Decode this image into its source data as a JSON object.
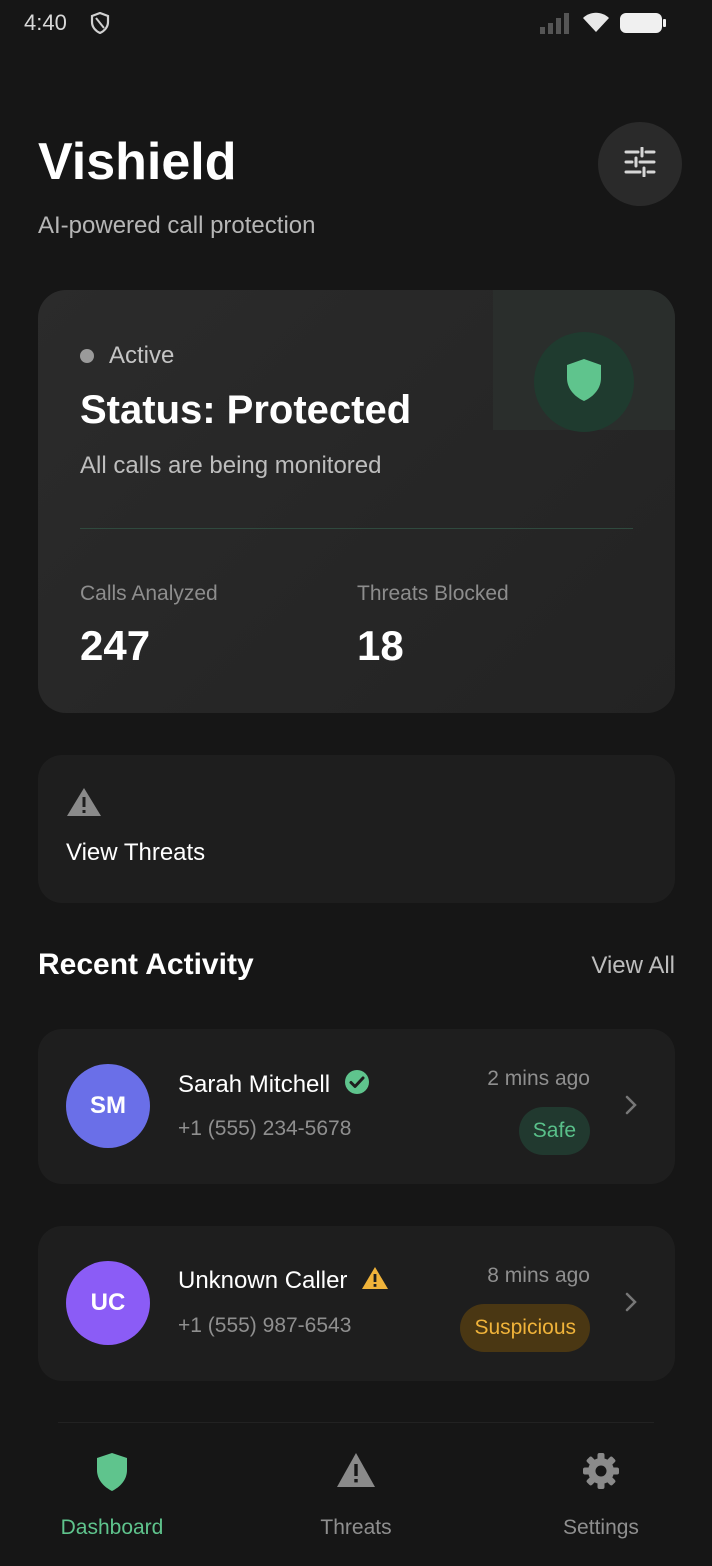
{
  "status_bar": {
    "time": "4:40"
  },
  "header": {
    "title": "Vishield",
    "subtitle": "AI-powered call protection"
  },
  "status_card": {
    "indicator": "Active",
    "title": "Status: Protected",
    "description": "All calls are being monitored",
    "stats": [
      {
        "label": "Calls Analyzed",
        "value": "247"
      },
      {
        "label": "Threats Blocked",
        "value": "18"
      }
    ]
  },
  "view_threats": {
    "label": "View Threats"
  },
  "recent_activity": {
    "title": "Recent Activity",
    "view_all": "View All",
    "items": [
      {
        "initials": "SM",
        "name": "Sarah Mitchell",
        "phone": "+1 (555) 234-5678",
        "time": "2 mins ago",
        "status": "Safe",
        "avatar_color": "#6a6fe8",
        "indicator_icon": "verified-check-icon"
      },
      {
        "initials": "UC",
        "name": "Unknown Caller",
        "phone": "+1 (555) 987-6543",
        "time": "8 mins ago",
        "status": "Suspicious",
        "avatar_color": "#8b5cf6",
        "indicator_icon": "warning-triangle-icon"
      }
    ]
  },
  "bottom_nav": {
    "items": [
      {
        "label": "Dashboard",
        "icon": "shield-icon",
        "active": true
      },
      {
        "label": "Threats",
        "icon": "warning-icon",
        "active": false
      },
      {
        "label": "Settings",
        "icon": "gear-icon",
        "active": false
      }
    ]
  },
  "colors": {
    "accent_green": "#5fc48d",
    "warning_amber": "#f0b33a",
    "background": "#161616",
    "card": "#1e1e1e"
  }
}
